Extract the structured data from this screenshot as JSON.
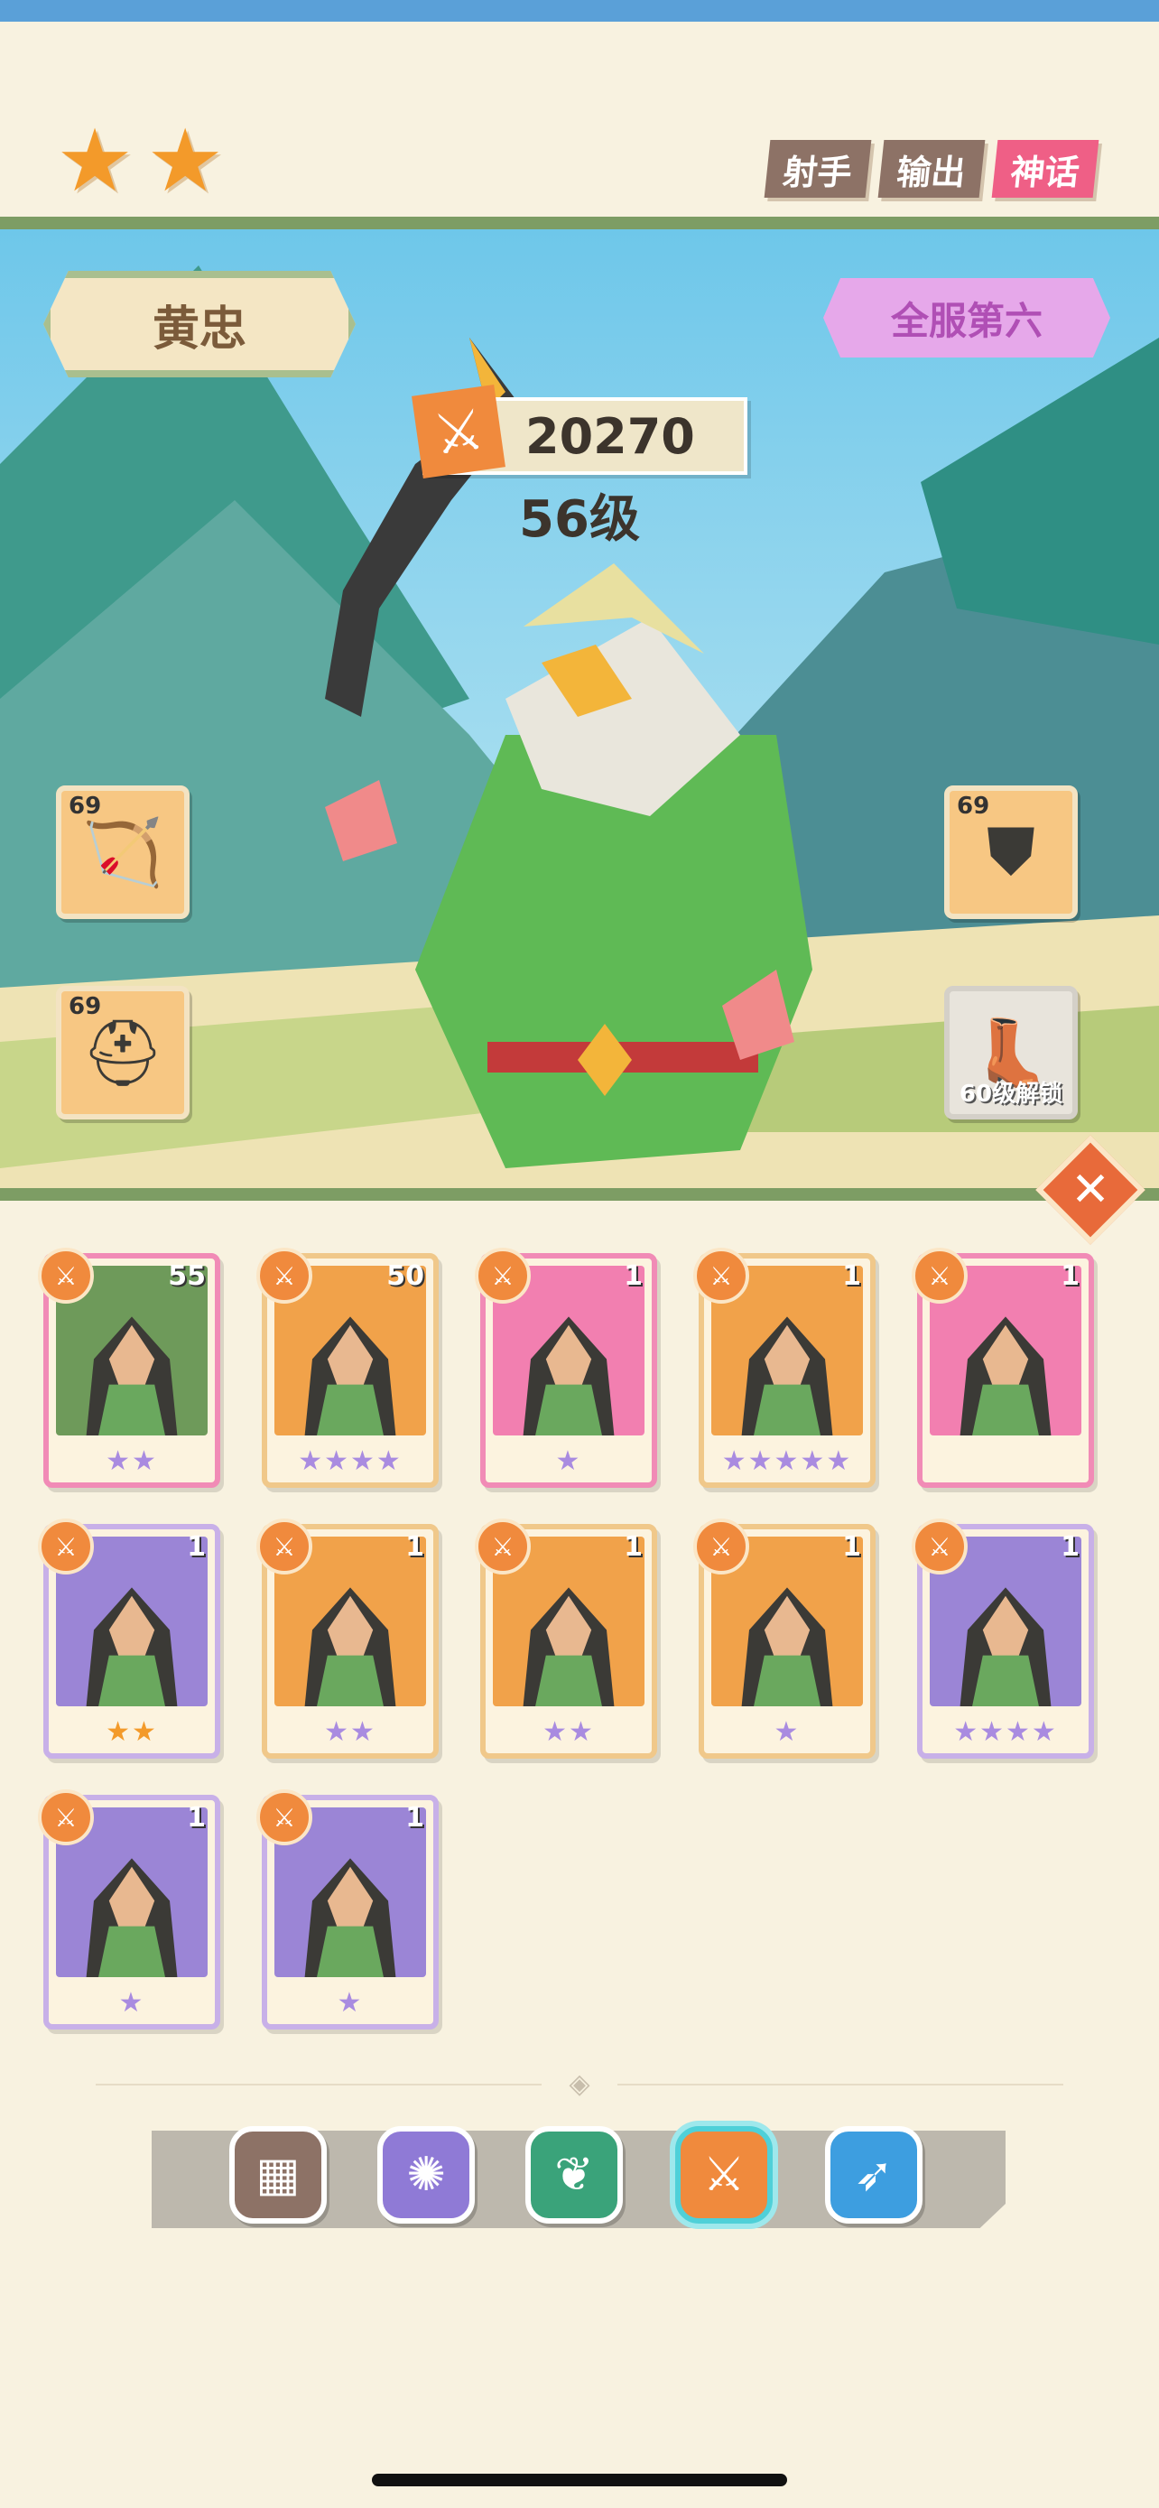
{
  "header": {
    "stars": 2,
    "tags": [
      "射手",
      "输出",
      "神话"
    ]
  },
  "hero": {
    "name": "黄忠",
    "server_rank": "全服第六",
    "power": "20270",
    "level": "56级"
  },
  "equipment": [
    {
      "slot": "weapon",
      "icon": "bow-icon",
      "level": "69"
    },
    {
      "slot": "helmet",
      "icon": "helmet-icon",
      "level": "69"
    },
    {
      "slot": "armor",
      "icon": "armor-icon",
      "level": "69"
    },
    {
      "slot": "boots",
      "icon": "boot-icon",
      "locked": true,
      "unlock_text": "60级解锁"
    }
  ],
  "roster": [
    {
      "level": "55",
      "stars": 2,
      "star_color": "purple",
      "frame": "pink",
      "bg": "#6e9a5a"
    },
    {
      "level": "50",
      "stars": 4,
      "star_color": "purple",
      "frame": "gold",
      "bg": "#f1a24a"
    },
    {
      "level": "1",
      "stars": 1,
      "star_color": "purple",
      "frame": "pink",
      "bg": "#f27fb0"
    },
    {
      "level": "1",
      "stars": 5,
      "star_color": "purple",
      "frame": "gold",
      "bg": "#f1a24a"
    },
    {
      "level": "1",
      "stars": 0,
      "star_color": "purple",
      "frame": "pink",
      "bg": "#f27fb0"
    },
    {
      "level": "1",
      "stars": 2,
      "star_color": "orange",
      "frame": "purple",
      "bg": "#9b85d6"
    },
    {
      "level": "1",
      "stars": 2,
      "star_color": "purple",
      "frame": "gold",
      "bg": "#f1a24a"
    },
    {
      "level": "1",
      "stars": 2,
      "star_color": "purple",
      "frame": "gold",
      "bg": "#f1a24a"
    },
    {
      "level": "1",
      "stars": 1,
      "star_color": "purple",
      "frame": "gold",
      "bg": "#f1a24a"
    },
    {
      "level": "1",
      "stars": 4,
      "star_color": "purple",
      "frame": "purple",
      "bg": "#9b85d6"
    },
    {
      "level": "1",
      "stars": 1,
      "star_color": "purple",
      "frame": "purple",
      "bg": "#9b85d6"
    },
    {
      "level": "1",
      "stars": 1,
      "star_color": "purple",
      "frame": "purple",
      "bg": "#9b85d6"
    }
  ],
  "filters": [
    {
      "name": "all",
      "icon": "grid-icon",
      "color": "#8d7266",
      "glyph": "▦",
      "active": false
    },
    {
      "name": "mage",
      "icon": "orb-icon",
      "color": "#8f7ad6",
      "glyph": "✺",
      "active": false
    },
    {
      "name": "support",
      "icon": "leaf-icon",
      "color": "#3aa37a",
      "glyph": "❦",
      "active": false
    },
    {
      "name": "warrior",
      "icon": "sword-icon",
      "color": "#f08a3d",
      "glyph": "⚔",
      "active": true
    },
    {
      "name": "archer",
      "icon": "bow-icon",
      "color": "#3d9ee0",
      "glyph": "➶",
      "active": false
    }
  ],
  "colors": {
    "background": "#f8f2e0",
    "accent_orange": "#f08a3d",
    "tag_myth": "#ef5f86",
    "rank_purple": "#b04fb5"
  }
}
